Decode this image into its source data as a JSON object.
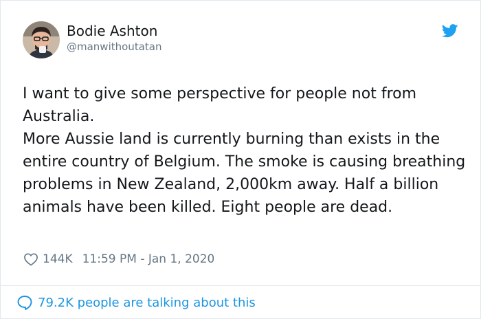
{
  "tweet": {
    "display_name": "Bodie Ashton",
    "handle": "@manwithoutatan",
    "paragraphs": [
      "I want to give some perspective for people not from Australia.",
      "More Aussie land is currently burning than exists in the entire country of Belgium. The smoke is causing breathing problems in New Zealand, 2,000km away. Half a billion animals have been killed. Eight people are dead."
    ],
    "likes": "144K",
    "time": "11:59 PM - Jan 1, 2020",
    "talking": "79.2K people are talking about this"
  },
  "icons": {
    "avatar": "avatar-photo",
    "brand": "twitter-bird-icon",
    "like": "heart-outline-icon",
    "reply": "speech-bubble-icon"
  },
  "colors": {
    "brand_blue": "#1da1f2",
    "link_blue": "#1b95e0",
    "text": "#14171a",
    "muted": "#657786",
    "border": "#e1e8ed"
  }
}
